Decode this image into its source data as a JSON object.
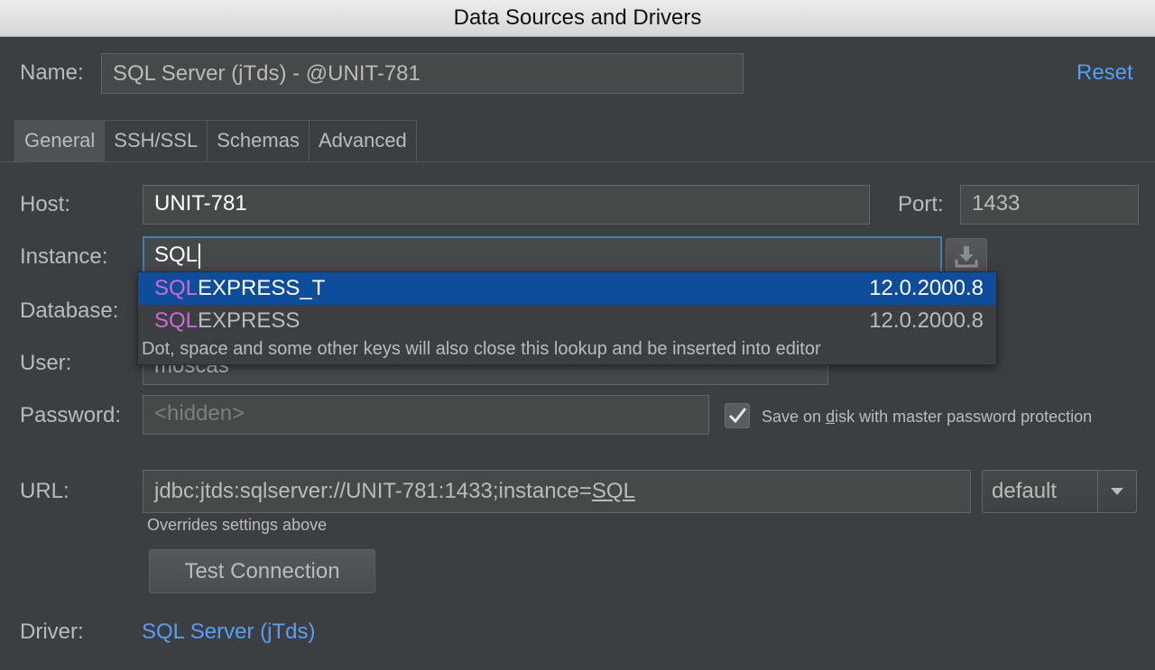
{
  "window": {
    "title": "Data Sources and Drivers"
  },
  "name_row": {
    "label": "Name:",
    "value": "SQL Server (jTds) - @UNIT-781",
    "reset": "Reset"
  },
  "tabs": [
    {
      "label": "General",
      "active": true
    },
    {
      "label": "SSH/SSL",
      "active": false
    },
    {
      "label": "Schemas",
      "active": false
    },
    {
      "label": "Advanced",
      "active": false
    }
  ],
  "general": {
    "host": {
      "label": "Host:",
      "value": "UNIT-781"
    },
    "port": {
      "label": "Port:",
      "value": "1433"
    },
    "instance": {
      "label": "Instance:",
      "value": "SQL"
    },
    "database": {
      "label": "Database:"
    },
    "user": {
      "label": "User:",
      "value": "moscas"
    },
    "password": {
      "label": "Password:",
      "placeholder": "<hidden>",
      "save_prefix": "Save on ",
      "save_mnemonic": "d",
      "save_suffix": "isk with master password protection",
      "save_checked": true
    },
    "url": {
      "label": "URL:",
      "prefix": "jdbc:jtds:sqlserver://UNIT-781:1433;instance=",
      "highlight": "SQL",
      "hint": "Overrides settings above",
      "mode": "default"
    },
    "test_button": "Test Connection",
    "driver": {
      "label": "Driver:",
      "value": "SQL Server (jTds)"
    }
  },
  "lookup": {
    "items": [
      {
        "match": "SQL",
        "rest": "EXPRESS_T",
        "version": "12.0.2000.8",
        "selected": true
      },
      {
        "match": "SQL",
        "rest": "EXPRESS",
        "version": "12.0.2000.8",
        "selected": false
      }
    ],
    "hint": "Dot, space and some other keys will also close this lookup and be inserted into editor"
  },
  "colors": {
    "background": "#3c3f41",
    "field": "#45494a",
    "selection": "#0d4d9b",
    "link": "#589df6",
    "match": "#cc6ad6"
  }
}
